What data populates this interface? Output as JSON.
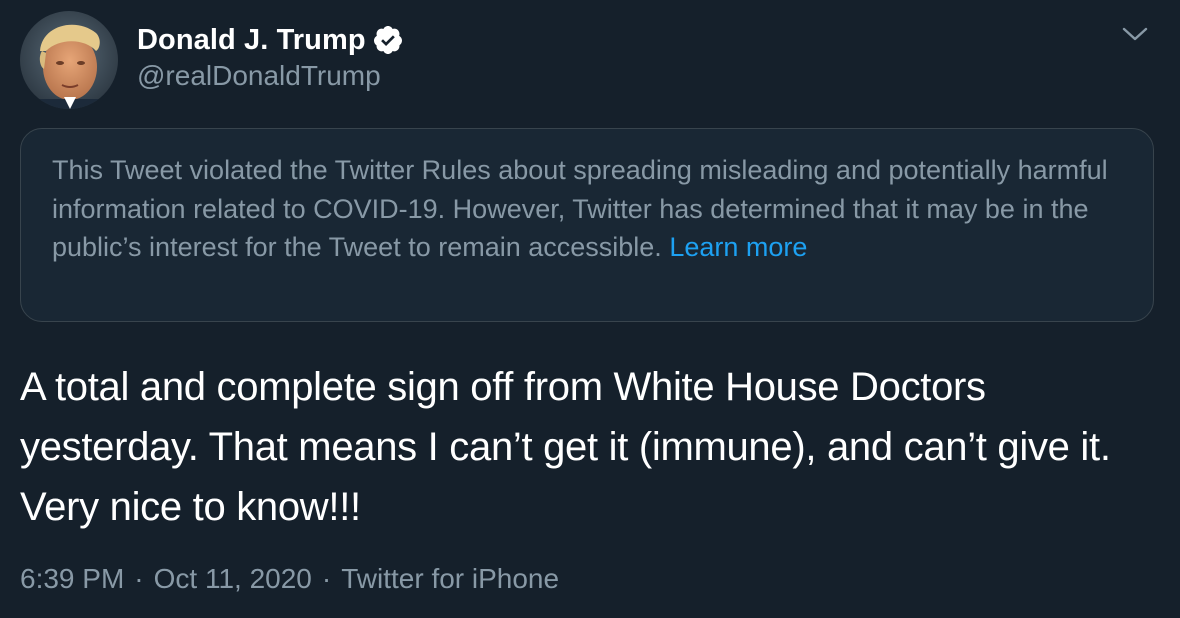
{
  "author": {
    "display_name": "Donald J. Trump",
    "handle": "@realDonaldTrump",
    "verified": true
  },
  "notice": {
    "text": "This Tweet violated the Twitter Rules about spreading misleading and potentially harmful information related to COVID-19. However, Twitter has determined that it may be in the public’s interest for the Tweet to remain accessible.",
    "link_label": "Learn more"
  },
  "tweet": {
    "text": "A total and complete sign off from White House Doctors yesterday. That means I can’t get it (immune), and can’t give it. Very nice to know!!!"
  },
  "meta": {
    "time": "6:39 PM",
    "date": "Oct 11, 2020",
    "separator": "·",
    "source": "Twitter for iPhone"
  },
  "icons": {
    "verified": "verified-badge-icon",
    "more": "chevron-down-icon"
  },
  "colors": {
    "background": "#15202b",
    "notice_background": "#192734",
    "border": "#38444d",
    "secondary_text": "#8899a6",
    "accent": "#1da1f2"
  }
}
